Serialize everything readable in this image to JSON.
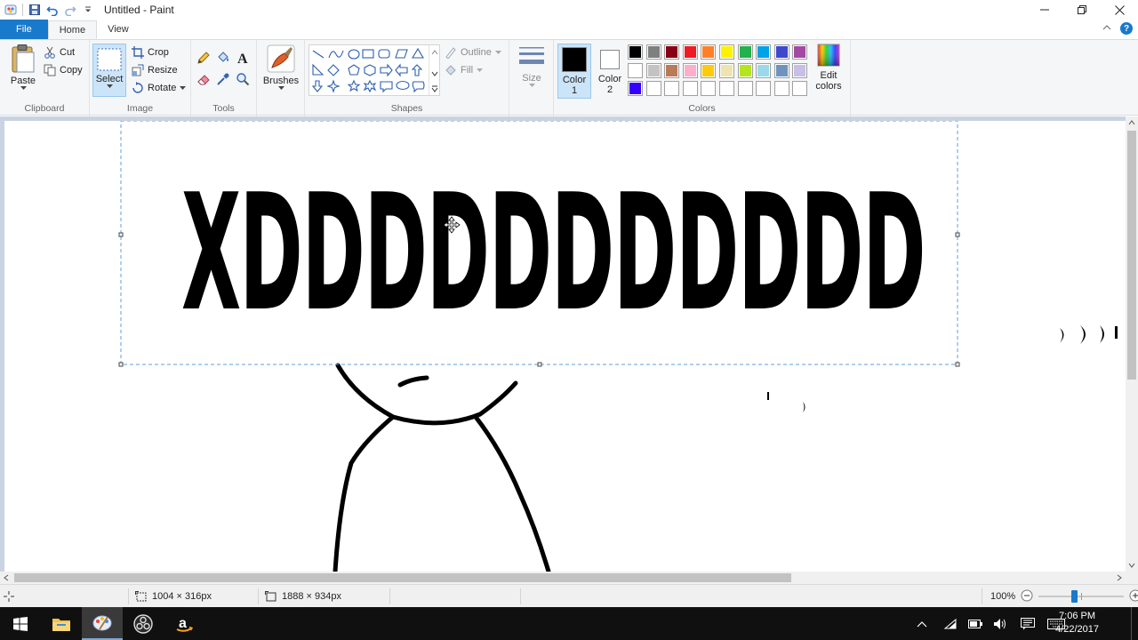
{
  "window": {
    "title": "Untitled - Paint"
  },
  "tabs": {
    "file": "File",
    "home": "Home",
    "view": "View"
  },
  "ribbon": {
    "clipboard": {
      "paste": "Paste",
      "cut": "Cut",
      "copy": "Copy",
      "label": "Clipboard"
    },
    "image": {
      "select": "Select",
      "crop": "Crop",
      "resize": "Resize",
      "rotate": "Rotate",
      "label": "Image"
    },
    "tools": {
      "label": "Tools"
    },
    "brushes": {
      "label": "Brushes"
    },
    "shapes": {
      "outline": "Outline",
      "fill": "Fill",
      "label": "Shapes"
    },
    "size": {
      "label": "Size"
    },
    "colors": {
      "color1": "Color 1",
      "color1_line1": "Color",
      "color1_line2": "1",
      "color2_line1": "Color",
      "color2_line2": "2",
      "edit_line1": "Edit",
      "edit_line2": "colors",
      "label": "Colors",
      "color1_value": "#000000",
      "color2_value": "#ffffff",
      "palette_row1": [
        "#000000",
        "#7f7f7f",
        "#880015",
        "#ed1c24",
        "#ff7f27",
        "#fff200",
        "#22b14c",
        "#00a2e8",
        "#3f48cc",
        "#a349a4"
      ],
      "palette_row2": [
        "#ffffff",
        "#c3c3c3",
        "#b97a57",
        "#ffaec9",
        "#ffc90e",
        "#efe4b0",
        "#b5e61d",
        "#99d9ea",
        "#7092be",
        "#c8bfe7"
      ],
      "palette_row3": [
        "#3300ff",
        "#ffffff",
        "#ffffff",
        "#ffffff",
        "#ffffff",
        "#ffffff",
        "#ffffff",
        "#ffffff",
        "#ffffff",
        "#ffffff"
      ]
    }
  },
  "canvas": {
    "text": "XDDDDDDDDDDD"
  },
  "status": {
    "selection_size": "1004 × 316px",
    "image_size": "1888 × 934px",
    "zoom": "100%"
  },
  "taskbar": {
    "time": "7:06 PM",
    "date": "4/22/2017"
  }
}
